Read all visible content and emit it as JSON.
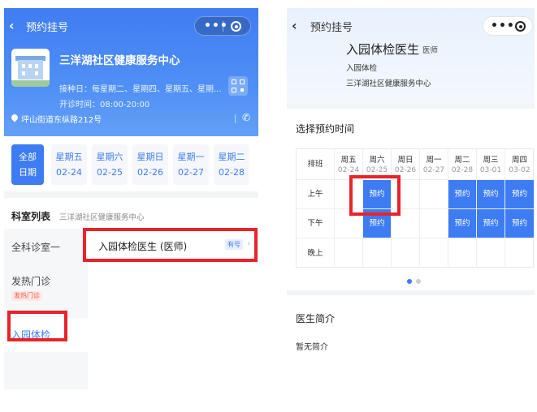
{
  "left": {
    "nav_title": "预约挂号",
    "hospital_name": "三洋湖社区健康服务中心",
    "service_days": "接种日：每星期二、星期四、星期五、星期...",
    "service_hours": "开诊时间：08:00-20:00",
    "address": "坪山街道东纵路212号",
    "date_all": [
      "全部",
      "日期"
    ],
    "dates": [
      {
        "weekday": "星期五",
        "date": "02-24"
      },
      {
        "weekday": "星期六",
        "date": "02-25"
      },
      {
        "weekday": "星期日",
        "date": "02-26"
      },
      {
        "weekday": "星期一",
        "date": "02-27"
      },
      {
        "weekday": "星期二",
        "date": "02-28"
      }
    ],
    "dept_list_title": "科室列表",
    "dept_list_sub": "三洋湖社区健康服务中心",
    "departments": [
      {
        "name": "全科诊室一",
        "tag": ""
      },
      {
        "name": "发热门诊",
        "tag": "发热门诊"
      },
      {
        "name": "入园体检",
        "tag": ""
      }
    ],
    "doctor_row": {
      "name": "入园体检医生 (医师)",
      "badge": "有号"
    }
  },
  "right": {
    "nav_title": "预约挂号",
    "doctor_name": "入园体检医生",
    "doctor_title": "医师",
    "department": "入园体检",
    "hospital": "三洋湖社区健康服务中心",
    "section_title": "选择预约时间",
    "schedule": {
      "corner": "排班",
      "columns": [
        {
          "weekday": "周五",
          "date": "02-24"
        },
        {
          "weekday": "周六",
          "date": "02-25"
        },
        {
          "weekday": "周日",
          "date": "02-26"
        },
        {
          "weekday": "周一",
          "date": "02-27"
        },
        {
          "weekday": "周二",
          "date": "02-28"
        },
        {
          "weekday": "周三",
          "date": "03-01"
        },
        {
          "weekday": "周四",
          "date": "03-02"
        }
      ],
      "rows": [
        {
          "label": "上午",
          "cells": [
            "",
            "预约",
            "",
            "",
            "预约",
            "预约",
            "预约"
          ]
        },
        {
          "label": "下午",
          "cells": [
            "",
            "预约",
            "",
            "",
            "预约",
            "预约",
            "预约"
          ]
        },
        {
          "label": "晚上",
          "cells": [
            "",
            "",
            "",
            "",
            "",
            "",
            ""
          ]
        }
      ]
    },
    "bio_title": "医生简介",
    "bio_text": "暂无简介"
  },
  "colors": {
    "primary": "#3d7cf2",
    "highlight": "#e8232a",
    "fever_tag": "#f05a4a"
  }
}
